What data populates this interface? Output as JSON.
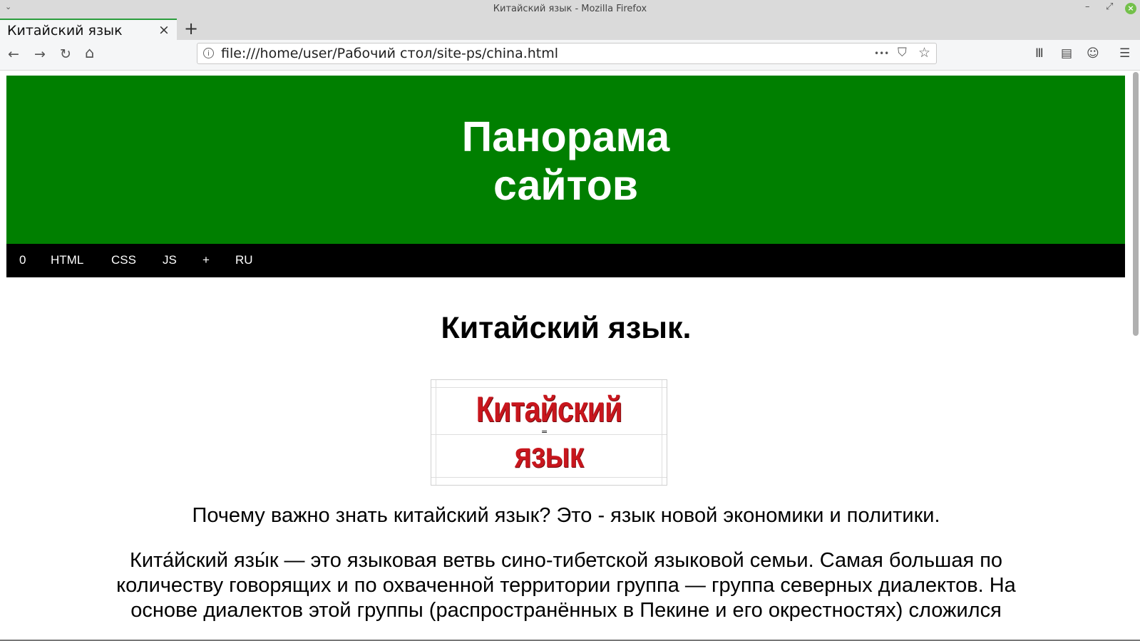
{
  "window": {
    "title": "Китайский язык - Mozilla Firefox",
    "menu_glyph": "⌄",
    "minimize_glyph": "–",
    "maximize_glyph": "⤢",
    "close_glyph": "×"
  },
  "tabs": [
    {
      "label": "Китайский язык",
      "active": true,
      "close_glyph": "×"
    }
  ],
  "new_tab_glyph": "+",
  "nav": {
    "back_glyph": "←",
    "forward_glyph": "→",
    "reload_glyph": "↻",
    "home_glyph": "⌂"
  },
  "urlbar": {
    "info_glyph": "i",
    "url": "file:///home/user/Рабочий стол/site-ps/china.html",
    "more_glyph": "•••",
    "pocket_glyph": "⛉",
    "bookmark_glyph": "☆"
  },
  "toolbar": {
    "library_glyph": "Ⅲ",
    "sidebar_glyph": "▤",
    "account_glyph": "☺",
    "menu_glyph": "☰"
  },
  "page": {
    "site_title_line1": "Панорама",
    "site_title_line2": "сайтов",
    "nav_links": [
      "0",
      "HTML",
      "CSS",
      "JS",
      "+",
      "RU"
    ],
    "heading": "Китайский язык.",
    "logo_line1": "Китайский",
    "logo_eq": "=",
    "logo_line2": "язык",
    "intro": "Почему важно знать китайский язык? Это - язык новой экономики и политики.",
    "body_line1": "Кита́йский язы́к — это языковая ветвь сино-тибетской языковой семьи. Самая большая по",
    "body_line2": "количеству говорящих и по охваченной территории группа — группа северных диалектов. На",
    "body_line3": "основе диалектов этой группы (распространённых в Пекине и его окрестностях) сложился"
  },
  "colors": {
    "header_green": "#007f00",
    "nav_black": "#000000",
    "logo_red": "#c8161d",
    "tab_accent": "#2a9d3c"
  }
}
